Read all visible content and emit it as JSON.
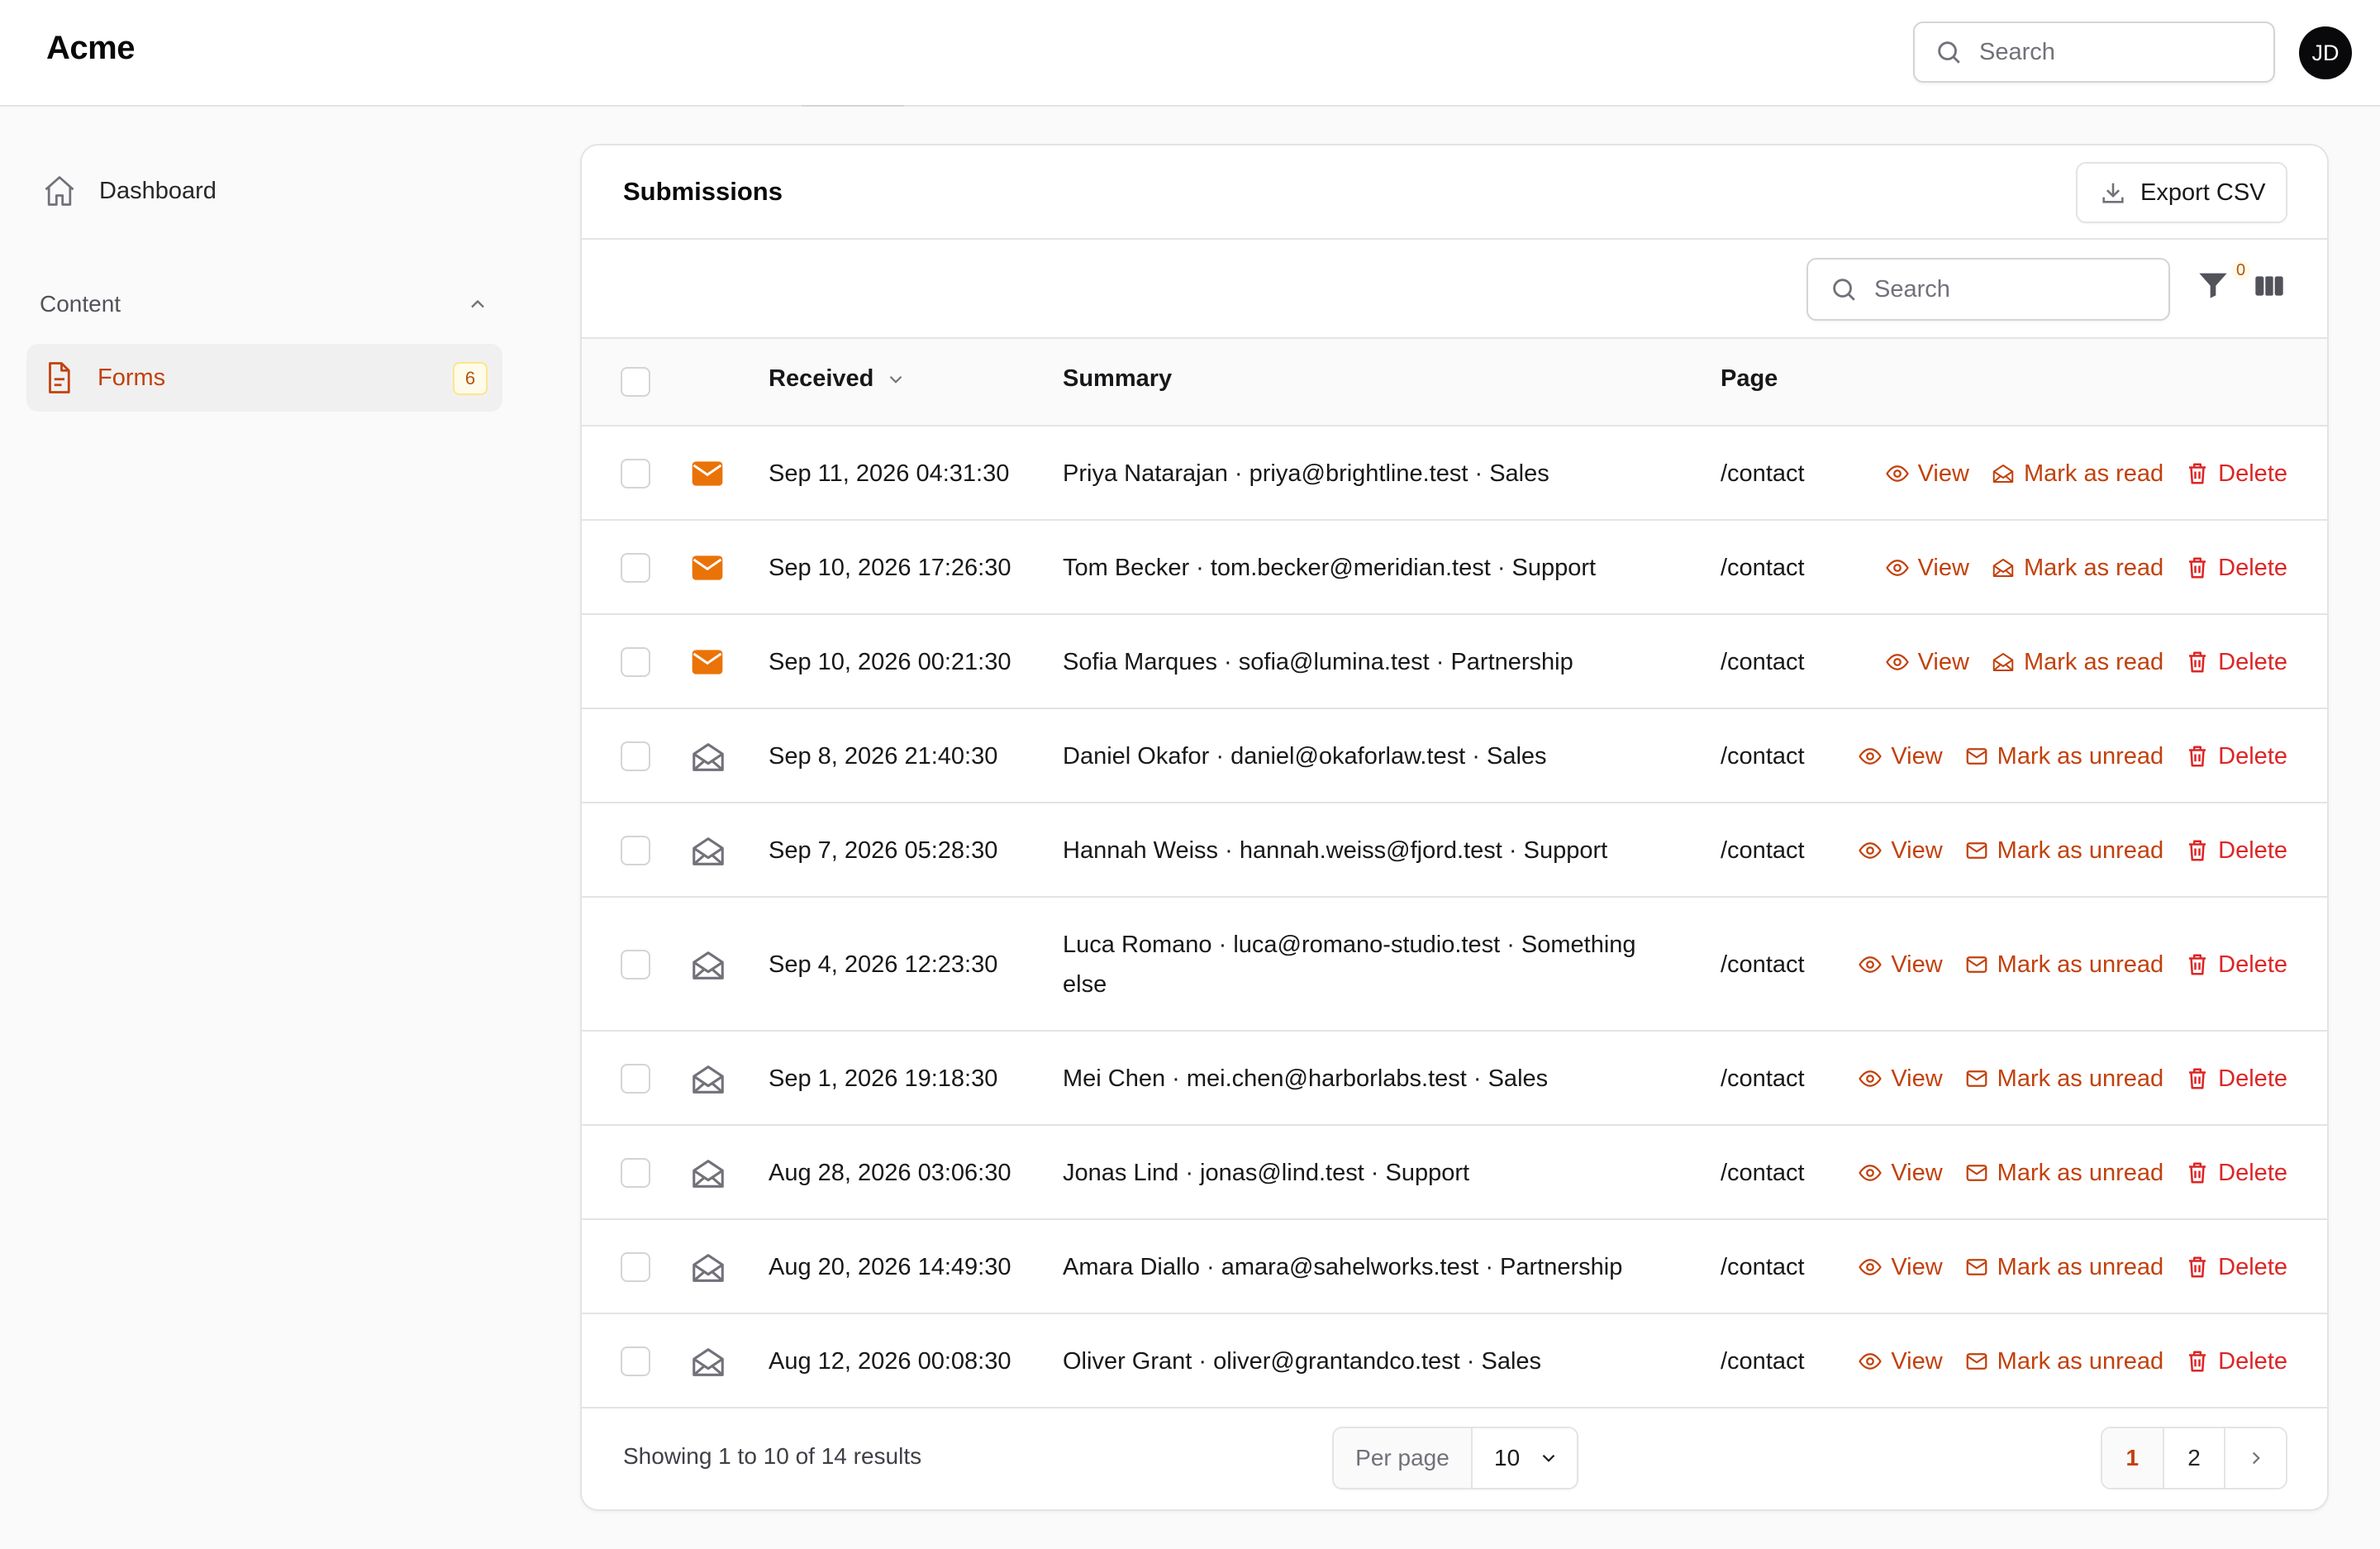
{
  "app": {
    "brand": "Acme",
    "avatar_initials": "JD",
    "search_placeholder": "Search"
  },
  "sidebar": {
    "dashboard_label": "Dashboard",
    "group_label": "Content",
    "forms_label": "Forms",
    "forms_count": "6"
  },
  "card": {
    "title": "Submissions",
    "export_label": "Export CSV",
    "search_placeholder": "Search",
    "filter_count": "0"
  },
  "table": {
    "columns": {
      "received": "Received",
      "summary": "Summary",
      "page": "Page"
    },
    "actions": {
      "view": "View",
      "mark_read": "Mark as read",
      "mark_unread": "Mark as unread",
      "delete": "Delete"
    },
    "rows": [
      {
        "received": "Sep 11, 2026 04:31:30",
        "summary": "Priya Natarajan · priya@brightline.test · Sales",
        "page": "/contact",
        "unread": true
      },
      {
        "received": "Sep 10, 2026 17:26:30",
        "summary": "Tom Becker · tom.becker@meridian.test · Support",
        "page": "/contact",
        "unread": true
      },
      {
        "received": "Sep 10, 2026 00:21:30",
        "summary": "Sofia Marques · sofia@lumina.test · Partnership",
        "page": "/contact",
        "unread": true
      },
      {
        "received": "Sep 8, 2026 21:40:30",
        "summary": "Daniel Okafor · daniel@okaforlaw.test · Sales",
        "page": "/contact",
        "unread": false
      },
      {
        "received": "Sep 7, 2026 05:28:30",
        "summary": "Hannah Weiss · hannah.weiss@fjord.test · Support",
        "page": "/contact",
        "unread": false
      },
      {
        "received": "Sep 4, 2026 12:23:30",
        "summary": "Luca Romano · luca@romano-studio.test · Something else",
        "page": "/contact",
        "unread": false
      },
      {
        "received": "Sep 1, 2026 19:18:30",
        "summary": "Mei Chen · mei.chen@harborlabs.test · Sales",
        "page": "/contact",
        "unread": false
      },
      {
        "received": "Aug 28, 2026 03:06:30",
        "summary": "Jonas Lind · jonas@lind.test · Support",
        "page": "/contact",
        "unread": false
      },
      {
        "received": "Aug 20, 2026 14:49:30",
        "summary": "Amara Diallo · amara@sahelworks.test · Partnership",
        "page": "/contact",
        "unread": false
      },
      {
        "received": "Aug 12, 2026 00:08:30",
        "summary": "Oliver Grant · oliver@grantandco.test · Sales",
        "page": "/contact",
        "unread": false
      }
    ]
  },
  "footer": {
    "showing": "Showing 1 to 10 of 14 results",
    "per_page_label": "Per page",
    "per_page_value": "10",
    "pages": [
      "1",
      "2"
    ],
    "current_page": "1"
  },
  "colors": {
    "accent": "#c2410c",
    "unread_icon": "#ea7308",
    "danger": "#dc2626"
  },
  "icons": [
    "home-icon",
    "chevron-up-icon",
    "document-icon",
    "download-icon",
    "search-icon",
    "filter-icon",
    "columns-icon",
    "chevron-down-icon",
    "envelope-closed-icon",
    "envelope-open-icon",
    "eye-icon",
    "trash-icon",
    "chevron-right-icon"
  ]
}
